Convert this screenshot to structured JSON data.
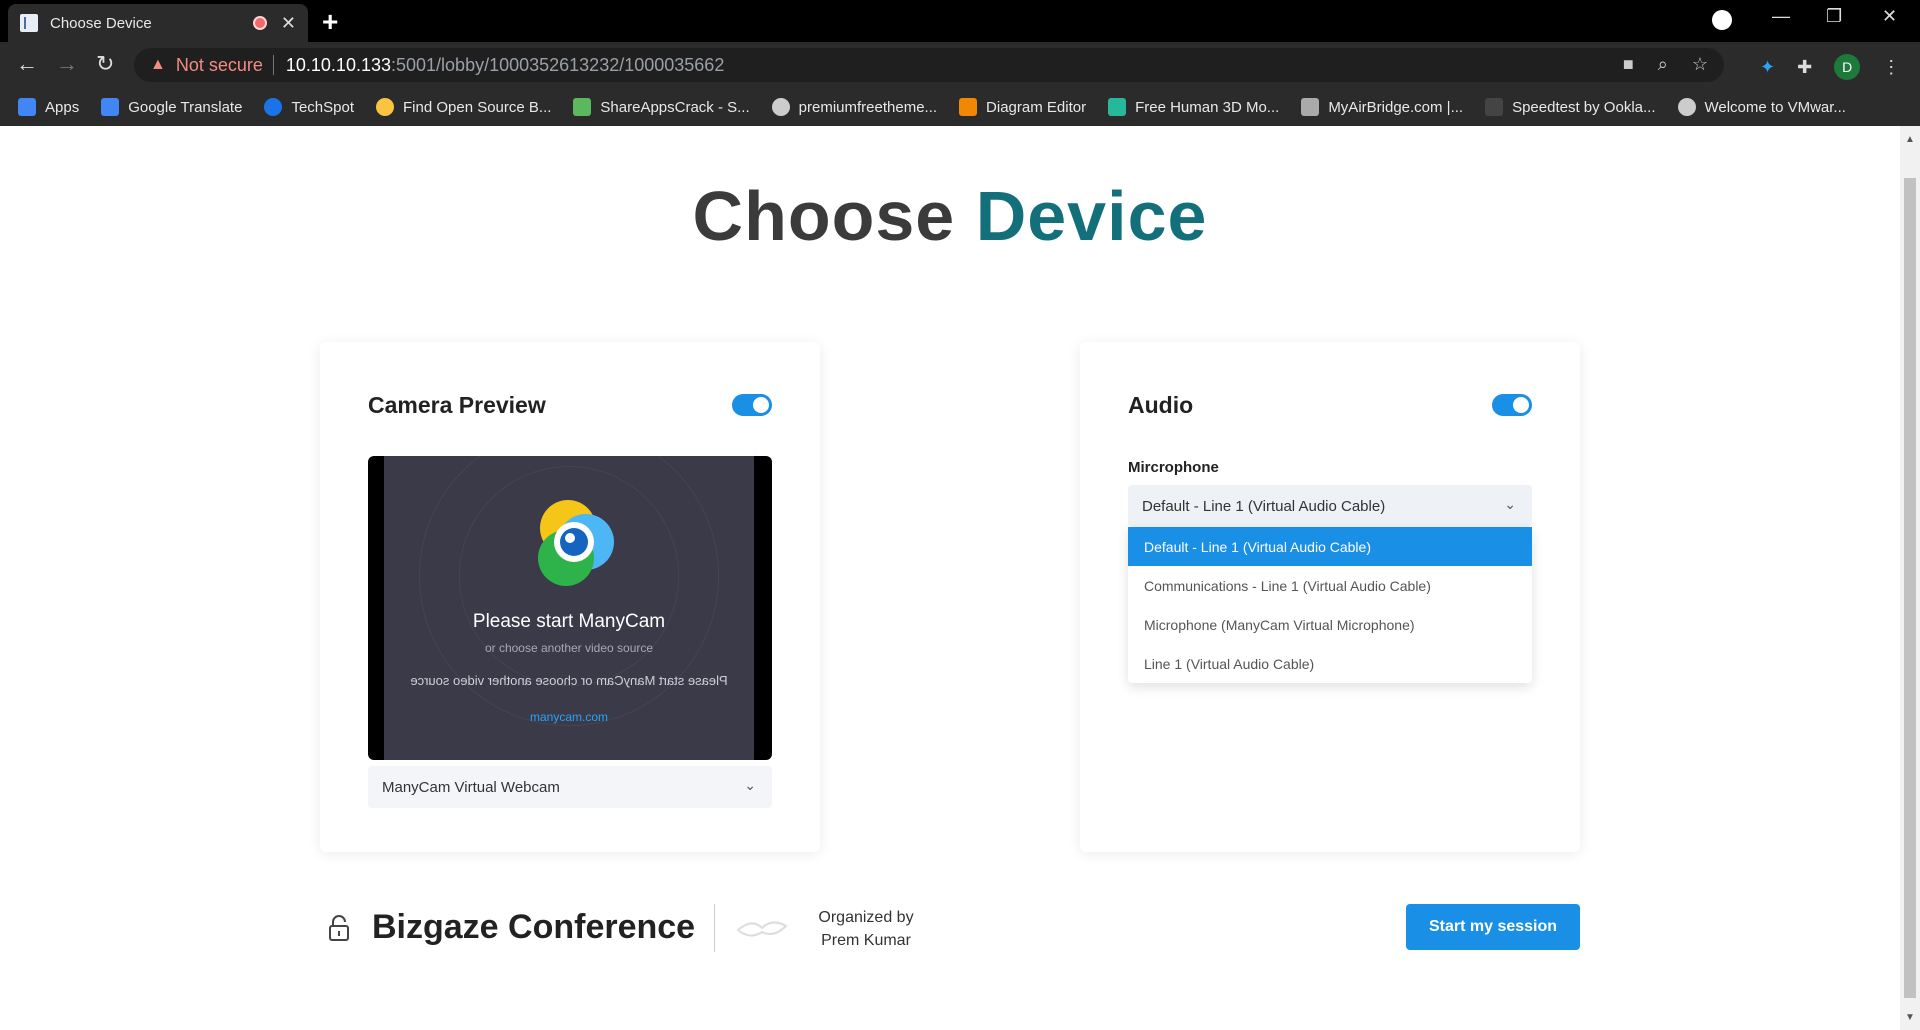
{
  "browser": {
    "tab_title": "Choose Device",
    "url_warning": "Not secure",
    "url_host": "10.10.10.133",
    "url_path": ":5001/lobby/1000352613232/1000035662",
    "profile_initial": "D",
    "bookmarks": [
      {
        "label": "Apps",
        "icon": "apps-grid-icon",
        "color": "#4285f4"
      },
      {
        "label": "Google Translate",
        "icon": "translate-icon",
        "color": "#4285f4"
      },
      {
        "label": "TechSpot",
        "icon": "techspot-icon",
        "color": "#1a73e8"
      },
      {
        "label": "Find Open Source B...",
        "icon": "emoji-icon",
        "color": "#f9c440"
      },
      {
        "label": "ShareAppsCrack - S...",
        "icon": "shareapps-icon",
        "color": "#5cb85c"
      },
      {
        "label": "premiumfreetheme...",
        "icon": "globe-icon",
        "color": "#cccccc"
      },
      {
        "label": "Diagram Editor",
        "icon": "diagram-icon",
        "color": "#f08705"
      },
      {
        "label": "Free Human 3D Mo...",
        "icon": "cgt-icon",
        "color": "#27b89c"
      },
      {
        "label": "MyAirBridge.com |...",
        "icon": "cloud-icon",
        "color": "#aaaaaa"
      },
      {
        "label": "Speedtest by Ookla...",
        "icon": "speedtest-icon",
        "color": "#444444"
      },
      {
        "label": "Welcome to VMwar...",
        "icon": "globe-icon",
        "color": "#cccccc"
      }
    ]
  },
  "page": {
    "heading_part1": "Choose",
    "heading_part2": "Device",
    "camera": {
      "title": "Camera Preview",
      "enabled": true,
      "preview_title": "Please start ManyCam",
      "preview_sub": "or choose another video source",
      "preview_mirror": "Please start ManyCam or choose another video source",
      "preview_link": "manycam.com",
      "selected_device": "ManyCam Virtual Webcam"
    },
    "audio": {
      "title": "Audio",
      "enabled": true,
      "field_label": "Mircrophone",
      "selected_device": "Default - Line 1 (Virtual Audio Cable)",
      "options": [
        "Default - Line 1 (Virtual Audio Cable)",
        "Communications - Line 1 (Virtual Audio Cable)",
        "Microphone (ManyCam Virtual Microphone)",
        "Line 1 (Virtual Audio Cable)"
      ],
      "highlighted_index": 0
    },
    "footer": {
      "conference_name": "Bizgaze Conference",
      "organized_by": "Organized by",
      "organizer": "Prem Kumar",
      "start_button": "Start my session"
    }
  },
  "colors": {
    "accent": "#1a8fe6",
    "heading_teal": "#13707a"
  }
}
